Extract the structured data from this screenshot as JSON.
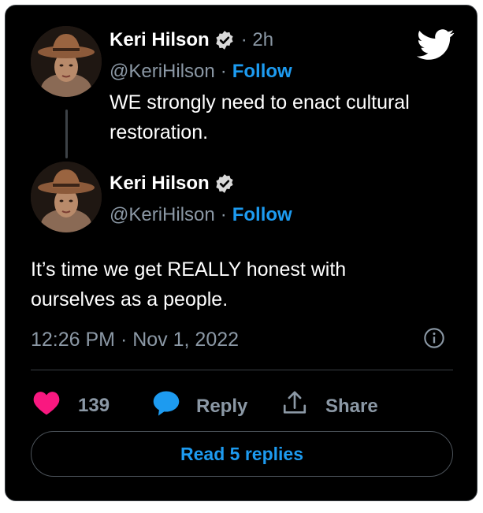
{
  "tweet1": {
    "author_name": "Keri Hilson",
    "time_ago": "· 2h",
    "handle": "@KeriHilson",
    "separator": "·",
    "follow_label": "Follow",
    "text": "WE strongly need to enact cultural restoration."
  },
  "tweet2": {
    "author_name": "Keri Hilson",
    "handle": "@KeriHilson",
    "separator": "·",
    "follow_label": "Follow",
    "text": "It’s time we get REALLY honest with ourselves as a people.",
    "timestamp": "12:26 PM · Nov 1, 2022"
  },
  "actions": {
    "like_count": "139",
    "reply_label": "Reply",
    "share_label": "Share"
  },
  "read_replies_label": "Read 5 replies",
  "colors": {
    "accent": "#1d9bf0",
    "like": "#f91880",
    "background": "#000000",
    "muted": "#8b98a5"
  },
  "icons": [
    "twitter-bird-icon",
    "verified-badge-icon",
    "heart-icon",
    "reply-bubble-icon",
    "share-icon",
    "info-icon"
  ]
}
